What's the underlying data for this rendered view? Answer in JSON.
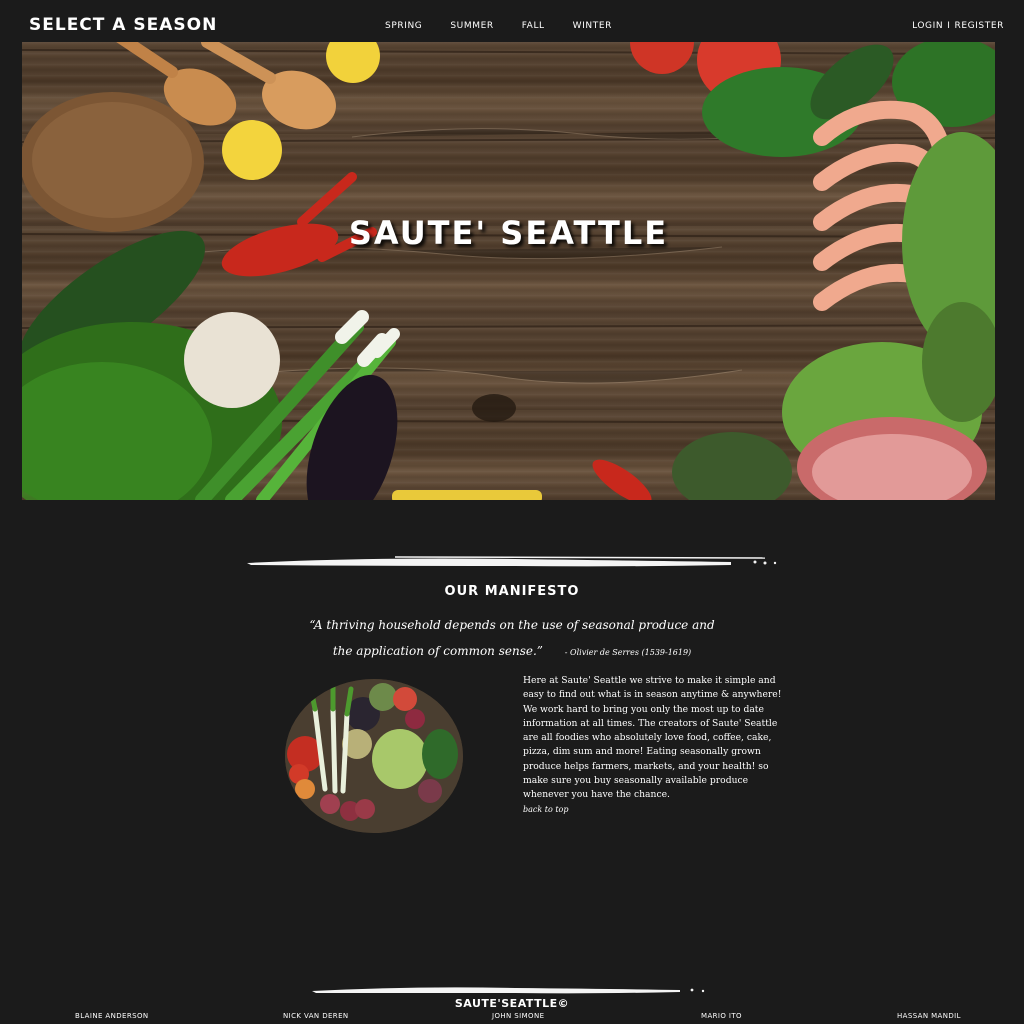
{
  "header": {
    "brand": "Select a Season",
    "nav": [
      "Spring",
      "Summer",
      "Fall",
      "Winter"
    ],
    "login_label": "Login",
    "separator": "I",
    "register_label": "Register"
  },
  "hero": {
    "title": "Saute' Seattle"
  },
  "manifesto": {
    "title": "Our Manifesto",
    "quote": "“A thriving household depends on the use of seasonal produce and the application of common sense.”",
    "cite": "- Olivier de Serres (1539-1619)",
    "body": "Here at Saute' Seattle we strive to make it simple and easy to find out what is in season anytime & anywhere! We work hard to bring you only the most up to date information at all times. The creators of Saute' Seattle are all foodies who absolutely love food, coffee, cake, pizza, dim sum and more! Eating seasonally grown produce helps farmers, markets, and your health! so make sure you buy seasonally available produce whenever you have the chance.",
    "back_to_top": "back to top"
  },
  "footer": {
    "title": "Saute'Seattle©",
    "credits": [
      "Blaine Anderson",
      "Nick van Deren",
      "John Simone",
      "Mario Ito",
      "Hassan Mandil"
    ]
  },
  "colors": {
    "background": "#1b1b1b",
    "wood": "#4e3b2a",
    "text": "#ffffff"
  }
}
